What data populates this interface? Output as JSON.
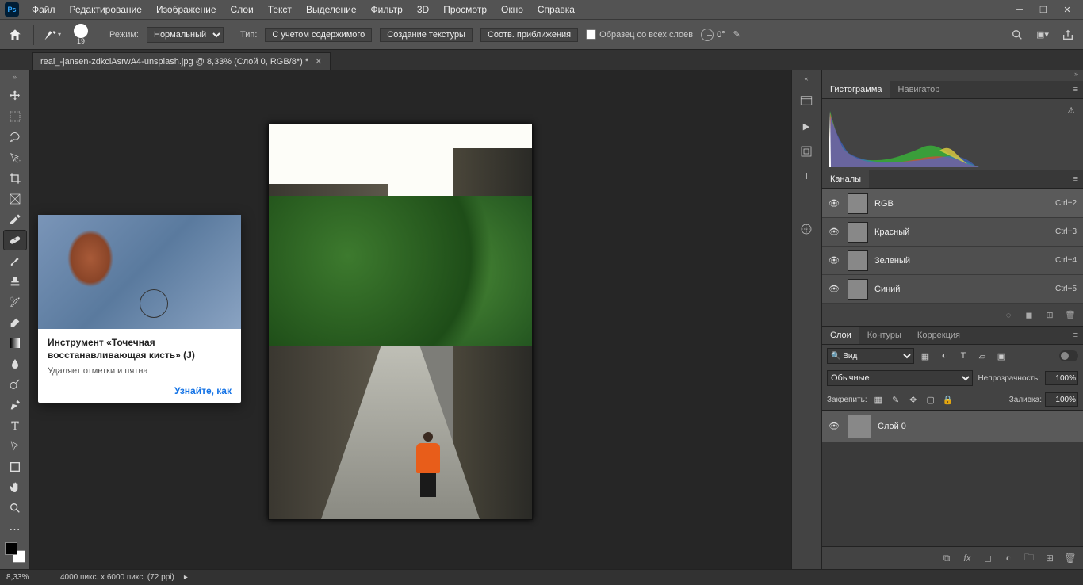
{
  "menubar": {
    "items": [
      "Файл",
      "Редактирование",
      "Изображение",
      "Слои",
      "Текст",
      "Выделение",
      "Фильтр",
      "3D",
      "Просмотр",
      "Окно",
      "Справка"
    ]
  },
  "optionsbar": {
    "brush_size": "19",
    "mode_label": "Режим:",
    "mode_value": "Нормальный",
    "type_label": "Тип:",
    "btn_content_aware": "С учетом содержимого",
    "btn_create_texture": "Создание текстуры",
    "btn_proximity": "Соотв. приближения",
    "sample_all_label": "Образец со всех слоев",
    "angle_value": "0°"
  },
  "doc_tab": {
    "title": "real_-jansen-zdkclAsrwA4-unsplash.jpg @ 8,33% (Слой 0, RGB/8*) *"
  },
  "tooltip": {
    "title": "Инструмент «Точечная восстанавливающая кисть» (J)",
    "desc": "Удаляет отметки и пятна",
    "link": "Узнайте, как"
  },
  "panels": {
    "hist_tab": "Гистограмма",
    "nav_tab": "Навигатор",
    "channels_tab": "Каналы",
    "channels": [
      {
        "name": "RGB",
        "shortcut": "Ctrl+2"
      },
      {
        "name": "Красный",
        "shortcut": "Ctrl+3"
      },
      {
        "name": "Зеленый",
        "shortcut": "Ctrl+4"
      },
      {
        "name": "Синий",
        "shortcut": "Ctrl+5"
      }
    ],
    "layers_tab": "Слои",
    "paths_tab": "Контуры",
    "adjust_tab": "Коррекция",
    "filter_kind": "Вид",
    "blend_mode": "Обычные",
    "opacity_label": "Непрозрачность:",
    "opacity_value": "100%",
    "lock_label": "Закрепить:",
    "fill_label": "Заливка:",
    "fill_value": "100%",
    "layer0": "Слой 0"
  },
  "statusbar": {
    "zoom": "8,33%",
    "docinfo": "4000 пикс. x 6000 пикс. (72 ppi)"
  }
}
